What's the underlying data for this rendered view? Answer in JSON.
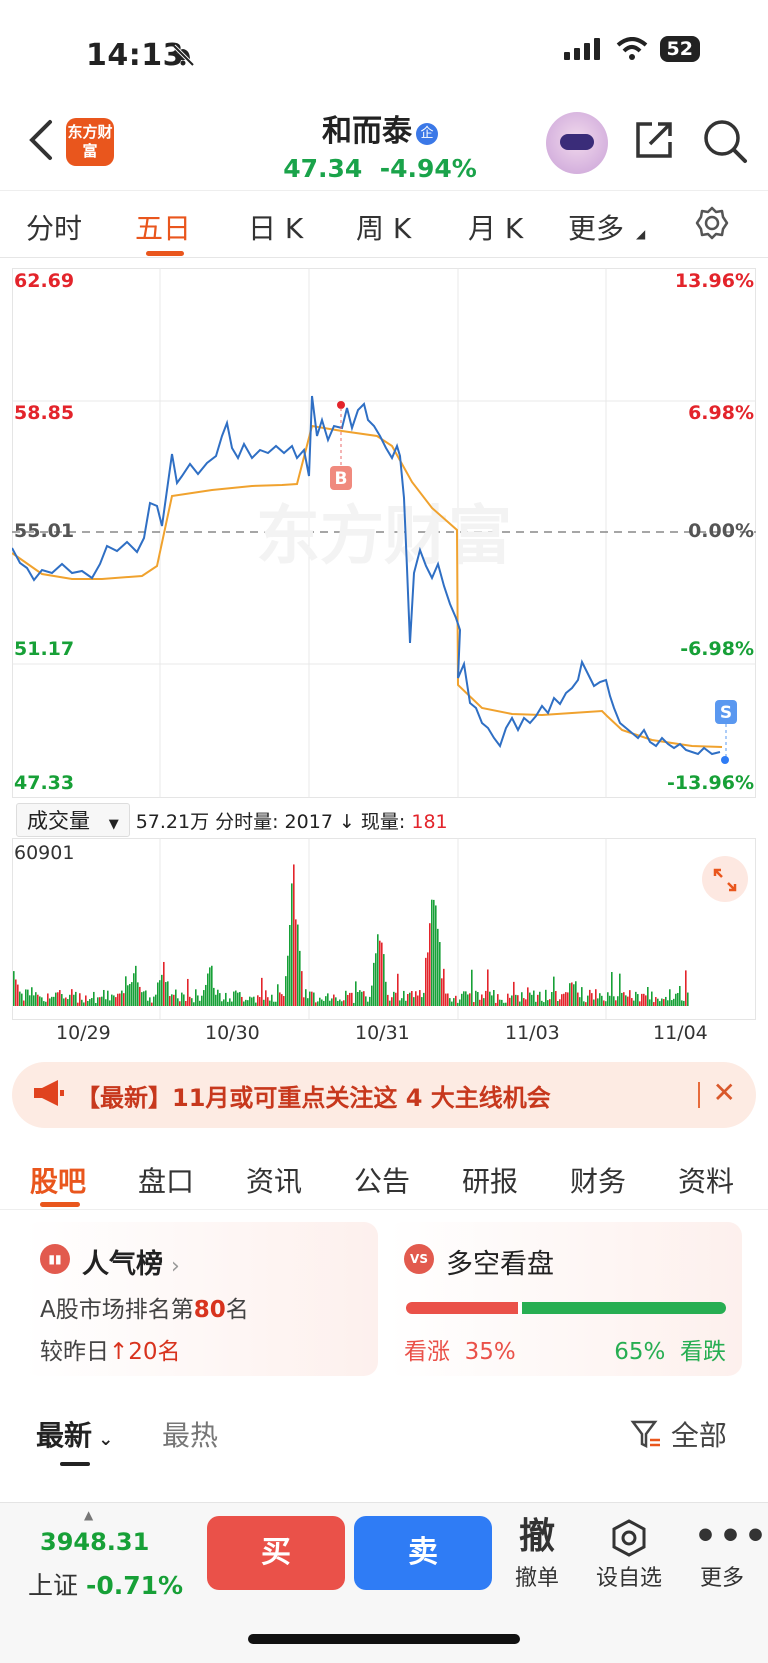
{
  "status_bar": {
    "time": "14:13",
    "battery": "52"
  },
  "header": {
    "logo_text": "东方财富",
    "stock_name": "和而泰",
    "ent_badge": "企",
    "price": "47.34",
    "change_pct": "-4.94%"
  },
  "period_tabs": [
    "分时",
    "五日",
    "日 K",
    "周 K",
    "月 K",
    "更多"
  ],
  "active_period": "五日",
  "chart": {
    "price_labels_left": [
      "62.69",
      "58.85",
      "55.01",
      "51.17",
      "47.33"
    ],
    "pct_labels_right": [
      "13.96%",
      "6.98%",
      "0.00%",
      "-6.98%",
      "-13.96%"
    ],
    "watermark": "东方财富",
    "buy_marker": "B",
    "sell_marker": "S",
    "volume_selector": "成交量",
    "volume_stats": "57.21万 分时量: 2017 ↓ 现量: ",
    "volume_current": "181",
    "volume_max": "60901",
    "x_labels": [
      "10/29",
      "10/30",
      "10/31",
      "11/03",
      "11/04"
    ]
  },
  "chart_data": {
    "type": "line",
    "title": "",
    "x": [
      "10/29",
      "10/30",
      "10/31",
      "11/03",
      "11/04"
    ],
    "ylim": [
      47.33,
      62.69
    ],
    "prev_close": 55.01,
    "series": [],
    "volume_max": 60901
  },
  "news_banner": {
    "text": "【最新】11月或可重点关注这 4 大主线机会"
  },
  "section_tabs": [
    "股吧",
    "盘口",
    "资讯",
    "公告",
    "研报",
    "财务",
    "资料"
  ],
  "popularity_card": {
    "title": "人气榜",
    "rank_prefix": "A股市场排名第",
    "rank": "80",
    "rank_suffix": "名",
    "change_prefix": "较昨日",
    "change": "20名"
  },
  "bull_bear_card": {
    "title": "多空看盘",
    "bull_label": "看涨",
    "bull_pct": "35%",
    "bear_pct": "65%",
    "bear_label": "看跌",
    "bull_fraction": 0.35
  },
  "feed_tabs": {
    "latest": "最新",
    "hot": "最热",
    "filter": "全部"
  },
  "bottom_bar": {
    "index_value": "3948.31",
    "index_name": "上证",
    "index_change": "-0.71%",
    "buy": "买",
    "sell": "卖",
    "cancel_icon": "撤",
    "cancel": "撤单",
    "watchlist": "设自选",
    "more": "更多"
  },
  "colors": {
    "accent": "#e9561d",
    "up": "#e3242b",
    "down": "#17a037",
    "buy": "#ea5149",
    "sell": "#2f7cf5"
  }
}
